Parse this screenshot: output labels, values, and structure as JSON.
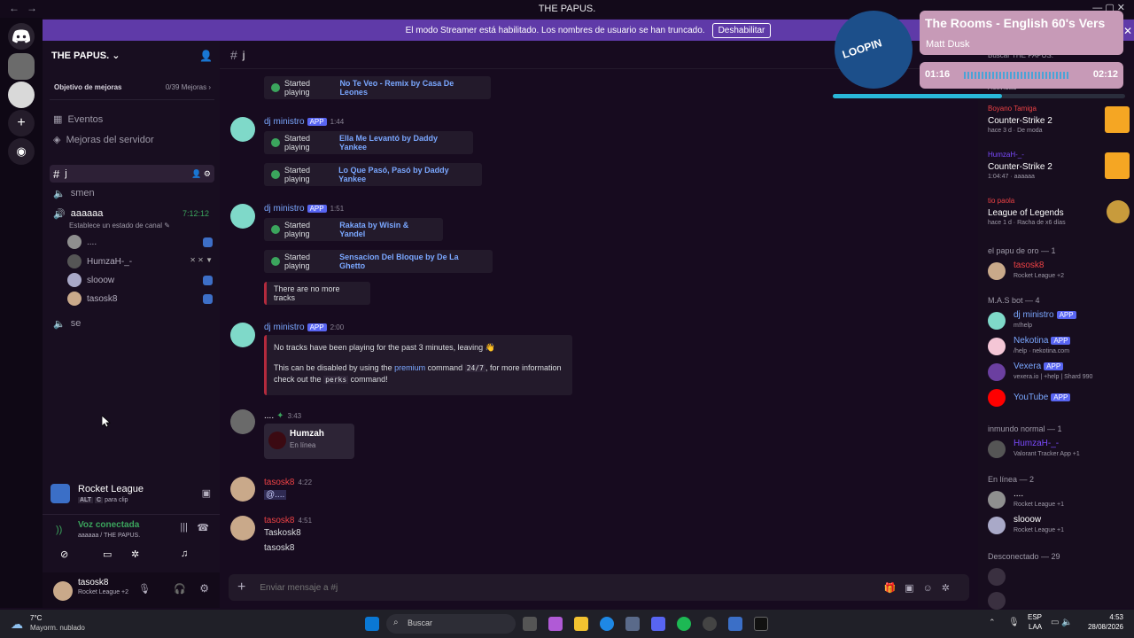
{
  "window": {
    "title": "THE PAPUS."
  },
  "banner": {
    "text": "El modo Streamer está habilitado. Los nombres de usuario se han truncado.",
    "button": "Deshabilitar"
  },
  "server": {
    "name": "THE PAPUS.",
    "goal": "Objetivo de mejoras",
    "goal_progress": "0/39 Mejoras",
    "events": "Eventos",
    "boosts": "Mejoras del servidor"
  },
  "channels": [
    {
      "name": "j"
    },
    {
      "name": "smen"
    },
    {
      "name": "aaaaaa",
      "timer": "7:12:12",
      "status": "Establece un estado de canal"
    },
    {
      "name": "se"
    }
  ],
  "voice_users": [
    "....",
    "HumzaH-_-",
    "slooow",
    "tasosk8"
  ],
  "game_activity": {
    "name": "Rocket League",
    "key1": "ALT",
    "key2": "C",
    "hint": "para clip"
  },
  "voice": {
    "title": "Voz conectada",
    "location": "aaaaaa / THE PAPUS."
  },
  "user": {
    "name": "tasosk8",
    "status": "Rocket League +2"
  },
  "chat": {
    "channel": "j",
    "input_placeholder": "Enviar mensaje a #j",
    "messages": [
      {
        "embed_prefix": "Started playing",
        "track": "No Te Veo - Remix by Casa De Leones"
      },
      {
        "author": "dj ministro",
        "app": "APP",
        "time": "1:44",
        "tracks": [
          "Ella Me Levantó by Daddy Yankee",
          "Lo Que Pasó, Pasó by Daddy Yankee"
        ]
      },
      {
        "author": "dj ministro",
        "app": "APP",
        "time": "1:51",
        "tracks": [
          "Rakata by Wisin & Yandel",
          "Sensacion Del Bloque by De La Ghetto"
        ],
        "notice": "There are no more tracks"
      },
      {
        "author": "dj ministro",
        "app": "APP",
        "time": "2:00",
        "line1": "No tracks have been playing for the past 3 minutes, leaving 👋",
        "line2a": "This can be disabled by using the",
        "line2b": "premium",
        "line2c": "command",
        "line2d": "24/7",
        "line2e": ", for more information",
        "line3a": "check out the",
        "line3b": "perks",
        "line3c": "command!"
      },
      {
        "author": "....",
        "time": "3:43",
        "card_name": "Humzah",
        "card_status": "En línea"
      },
      {
        "author": "tasosk8",
        "time": "4:22",
        "text": "@...."
      },
      {
        "author": "tasosk8",
        "time": "4:51",
        "text": "Taskosk8",
        "text2": "tasosk8"
      }
    ]
  },
  "members": {
    "search": "Buscar THE PAPUS.",
    "activity_title": "Actividad",
    "activities": [
      {
        "user": "Boyano Tamiga",
        "game": "Counter-Strike 2",
        "meta": "hace 3 d",
        "meta2": "De moda"
      },
      {
        "user": "HumzaH-_-",
        "game": "Counter-Strike 2",
        "meta": "1:04:47",
        "meta2": "aaaaaa"
      },
      {
        "user": "tio paola",
        "game": "League of Legends",
        "meta": "hace 1 d",
        "meta2": "Racha de x6 días"
      }
    ],
    "sections": [
      {
        "title": "el papu de oro — 1",
        "rows": [
          {
            "name": "tasosk8",
            "sub": "Rocket League +2"
          }
        ]
      },
      {
        "title": "M.A.S bot — 4",
        "rows": [
          {
            "name": "dj ministro",
            "app": "APP",
            "sub": "m!help"
          },
          {
            "name": "Nekotina",
            "app": "APP",
            "sub": "/help · nekotina.com"
          },
          {
            "name": "Vexera",
            "app": "APP",
            "sub": "vexera.io | +help | Shard 990"
          },
          {
            "name": "YouTube",
            "app": "APP",
            "sub": ""
          }
        ]
      },
      {
        "title": "inmundo normal — 1",
        "rows": [
          {
            "name": "HumzaH-_-",
            "sub": "Valorant Tracker App +1"
          }
        ]
      },
      {
        "title": "En línea — 2",
        "rows": [
          {
            "name": "....",
            "sub": "Rocket League +1"
          },
          {
            "name": "slooow",
            "sub": "Rocket League +1"
          }
        ]
      },
      {
        "title": "Desconectado — 29",
        "rows": []
      }
    ]
  },
  "music": {
    "song": "The Rooms - English 60's Vers",
    "artist": "Matt Dusk",
    "elapsed": "01:16",
    "total": "02:12",
    "progress": 0.58,
    "cover_text": "LOOPIN"
  },
  "taskbar": {
    "temp": "7°C",
    "weather": "Mayorm. nublado",
    "search": "Buscar",
    "lang1": "ESP",
    "lang2": "LAA",
    "time": "4:53",
    "date": "28/08/2026"
  },
  "colors": {
    "accent": "#5865f2",
    "banner": "#5f3aa8",
    "red_name": "#ed4245",
    "blue_name": "#7aa7ff"
  }
}
